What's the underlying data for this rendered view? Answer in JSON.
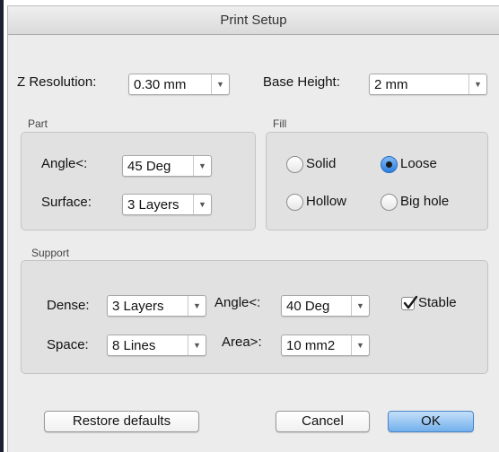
{
  "window": {
    "title": "Print Setup"
  },
  "general": {
    "z_resolution": {
      "label": "Z Resolution:",
      "value": "0.30 mm"
    },
    "base_height": {
      "label": "Base Height:",
      "value": "2 mm"
    }
  },
  "part": {
    "title": "Part",
    "angle": {
      "label": "Angle<:",
      "value": "45 Deg"
    },
    "surface": {
      "label": "Surface:",
      "value": "3 Layers"
    }
  },
  "fill": {
    "title": "Fill",
    "options": [
      "Solid",
      "Loose",
      "Hollow",
      "Big hole"
    ],
    "selected": "Loose"
  },
  "support": {
    "title": "Support",
    "dense": {
      "label": "Dense:",
      "value": "3 Layers"
    },
    "angle": {
      "label": "Angle<:",
      "value": "40 Deg"
    },
    "space": {
      "label": "Space:",
      "value": "8 Lines"
    },
    "area": {
      "label": "Area>:",
      "value": "10 mm2"
    },
    "stable": {
      "label": "Stable",
      "checked": true
    }
  },
  "buttons": {
    "restore": "Restore defaults",
    "cancel": "Cancel",
    "ok": "OK"
  },
  "colors": {
    "accent": "#2c7fe0",
    "default_button": "#73b0ec",
    "group_bg": "#e1e1e1",
    "window_bg": "#ececec"
  },
  "icons": {
    "popup_arrow": "chevron-down-icon",
    "check": "checkmark-icon"
  }
}
